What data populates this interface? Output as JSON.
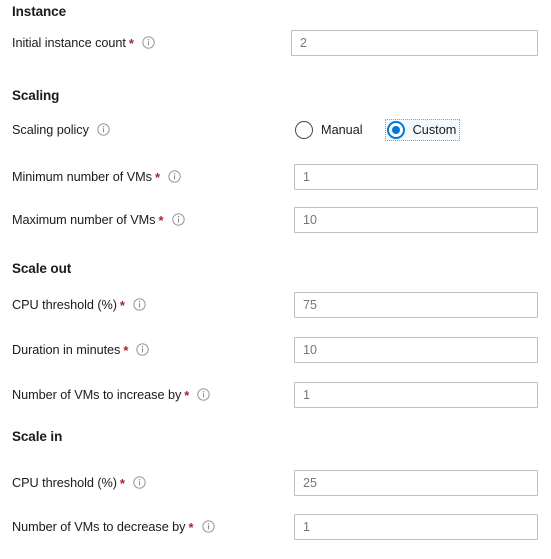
{
  "colors": {
    "required_asterisk": "#a4262c",
    "accent": "#0078d4",
    "input_border": "#bfbfbf",
    "input_text": "#767676",
    "text": "#1b1b1b",
    "focus_outline": "#6aa9e0"
  },
  "sections": [
    {
      "heading": "Instance",
      "fields": [
        {
          "label": "Initial instance count",
          "required": true,
          "info": true,
          "type": "text",
          "value": "2"
        }
      ]
    },
    {
      "heading": "Scaling",
      "fields": [
        {
          "label": "Scaling policy",
          "required": false,
          "info": true,
          "type": "radio",
          "options": [
            "Manual",
            "Custom"
          ],
          "selected": "Custom"
        },
        {
          "label": "Minimum number of VMs",
          "required": true,
          "info": true,
          "type": "text",
          "value": "1"
        },
        {
          "label": "Maximum number of VMs",
          "required": true,
          "info": true,
          "type": "text",
          "value": "10"
        }
      ]
    },
    {
      "heading": "Scale out",
      "fields": [
        {
          "label": "CPU threshold (%)",
          "required": true,
          "info": true,
          "type": "text",
          "value": "75"
        },
        {
          "label": "Duration in minutes",
          "required": true,
          "info": true,
          "type": "text",
          "value": "10"
        },
        {
          "label": "Number of VMs to increase by",
          "required": true,
          "info": true,
          "type": "text",
          "value": "1"
        }
      ]
    },
    {
      "heading": "Scale in",
      "fields": [
        {
          "label": "CPU threshold (%)",
          "required": true,
          "info": true,
          "type": "text",
          "value": "25"
        },
        {
          "label": "Number of VMs to decrease by",
          "required": true,
          "info": true,
          "type": "text",
          "value": "1"
        }
      ]
    }
  ],
  "icons": {
    "info": "info-icon"
  }
}
